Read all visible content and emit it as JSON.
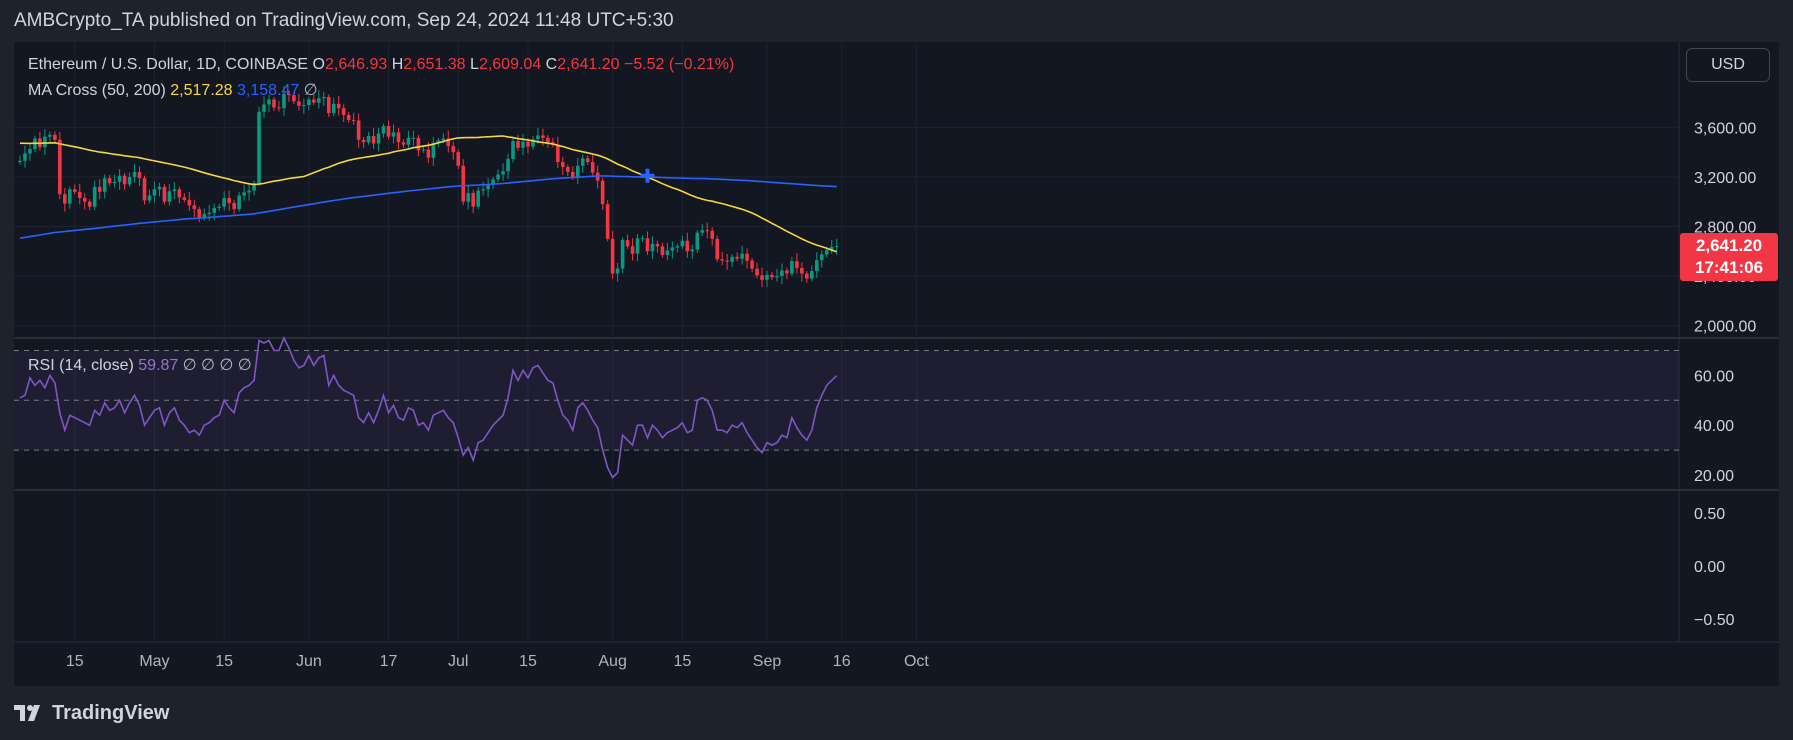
{
  "header": {
    "publisher_line": "AMBCrypto_TA published on TradingView.com, Sep 24, 2024 11:48 UTC+5:30"
  },
  "legend": {
    "symbol": "Ethereum / U.S. Dollar, 1D, COINBASE",
    "o_label": "O",
    "o_value": "2,646.93",
    "h_label": "H",
    "h_value": "2,651.38",
    "l_label": "L",
    "l_value": "2,609.04",
    "c_label": "C",
    "c_value": "2,641.20",
    "change": "−5.52 (−0.21%)",
    "ma_label": "MA Cross (50, 200)",
    "ma50_value": "2,517.28",
    "ma200_value": "3,158.47",
    "ma_empty": "∅",
    "rsi_label": "RSI (14, close)",
    "rsi_value": "59.87",
    "rsi_empties": "∅  ∅  ∅  ∅"
  },
  "currency_button": "USD",
  "last_price": {
    "price": "2,641.20",
    "countdown": "17:41:06"
  },
  "footer": {
    "brand": "TradingView"
  },
  "colors": {
    "up": "#089981",
    "down": "#f23645",
    "ma50": "#f5d742",
    "ma200": "#2962ff",
    "rsi": "#7e57c2",
    "rsi_band": "#7e57c2"
  },
  "chart_data": [
    {
      "type": "candlestick",
      "title": "Ethereum / U.S. Dollar, 1D, COINBASE",
      "x_tick_labels": [
        "15",
        "May",
        "15",
        "Jun",
        "17",
        "Jul",
        "15",
        "Aug",
        "15",
        "Sep",
        "16",
        "Oct"
      ],
      "x_tick_dates": [
        "2024-04-15",
        "2024-05-01",
        "2024-05-15",
        "2024-06-01",
        "2024-06-17",
        "2024-07-01",
        "2024-07-15",
        "2024-08-01",
        "2024-08-15",
        "2024-09-01",
        "2024-09-16",
        "2024-10-01"
      ],
      "y_tick_labels": [
        "3,600.00",
        "3,200.00",
        "2,800.00",
        "2,400.00",
        "2,000.00"
      ],
      "y_ticks": [
        3600,
        3200,
        2800,
        2400,
        2000
      ],
      "ylim": [
        1900,
        3950
      ],
      "start_date": "2024-04-04",
      "end_date": "2024-09-24",
      "closes": [
        3330,
        3390,
        3425,
        3510,
        3440,
        3525,
        3540,
        3500,
        3060,
        2985,
        3100,
        3080,
        3030,
        3000,
        2960,
        3120,
        3080,
        3190,
        3150,
        3160,
        3210,
        3140,
        3200,
        3240,
        3190,
        3010,
        3050,
        3100,
        3120,
        3000,
        3085,
        3100,
        3035,
        3015,
        2970,
        2940,
        2870,
        2900,
        2910,
        2950,
        2960,
        3030,
        2990,
        2940,
        3050,
        3075,
        3090,
        3150,
        3725,
        3785,
        3825,
        3760,
        3755,
        3870,
        3860,
        3810,
        3775,
        3780,
        3825,
        3800,
        3835,
        3845,
        3715,
        3790,
        3755,
        3700,
        3660,
        3655,
        3500,
        3480,
        3530,
        3470,
        3550,
        3610,
        3525,
        3560,
        3480,
        3460,
        3515,
        3515,
        3415,
        3420,
        3355,
        3475,
        3495,
        3510,
        3450,
        3400,
        3290,
        3000,
        3070,
        2960,
        3090,
        3100,
        3140,
        3180,
        3220,
        3245,
        3345,
        3490,
        3435,
        3485,
        3445,
        3505,
        3535,
        3515,
        3480,
        3460,
        3320,
        3280,
        3240,
        3200,
        3290,
        3350,
        3320,
        3235,
        3170,
        2980,
        2700,
        2420,
        2460,
        2690,
        2640,
        2580,
        2705,
        2705,
        2600,
        2660,
        2640,
        2570,
        2605,
        2630,
        2640,
        2685,
        2600,
        2615,
        2750,
        2770,
        2765,
        2700,
        2535,
        2525,
        2515,
        2555,
        2540,
        2580,
        2525,
        2460,
        2405,
        2370,
        2410,
        2390,
        2400,
        2445,
        2420,
        2520,
        2465,
        2420,
        2380,
        2440,
        2528,
        2575,
        2610,
        2635,
        2641.2
      ]
    },
    {
      "type": "line",
      "title": "MA Cross (50, 200)",
      "series": [
        {
          "name": "MA 50",
          "last_value": 2517.28
        },
        {
          "name": "MA 200",
          "last_value": 3158.47
        }
      ]
    },
    {
      "type": "line",
      "title": "RSI (14, close)",
      "y_tick_labels": [
        "60.00",
        "40.00",
        "20.00"
      ],
      "y_ticks": [
        60,
        40,
        20
      ],
      "ylim": [
        14,
        75
      ],
      "bands": [
        70,
        50,
        30
      ],
      "values": [
        51,
        52,
        59,
        56,
        58,
        55,
        60,
        57,
        45,
        38,
        44,
        43,
        42,
        41,
        40,
        46,
        44,
        49,
        46,
        47,
        50,
        45,
        49,
        52,
        48,
        40,
        43,
        46,
        47,
        40,
        45,
        47,
        42,
        40,
        37,
        38,
        36,
        40,
        41,
        43,
        44,
        50,
        47,
        45,
        53,
        55,
        56,
        58,
        74,
        73,
        74,
        70,
        70,
        75,
        71,
        66,
        63,
        64,
        68,
        64,
        67,
        68,
        56,
        60,
        56,
        54,
        53,
        52,
        43,
        41,
        45,
        41,
        46,
        52,
        45,
        48,
        43,
        42,
        47,
        46,
        40,
        41,
        38,
        44,
        45,
        46,
        43,
        41,
        35,
        28,
        31,
        26,
        33,
        34,
        37,
        40,
        42,
        44,
        51,
        62,
        58,
        62,
        59,
        63,
        64,
        61,
        58,
        57,
        50,
        44,
        42,
        38,
        47,
        49,
        46,
        42,
        39,
        30,
        23,
        19,
        21,
        36,
        34,
        32,
        40,
        40,
        35,
        40,
        38,
        35,
        37,
        38,
        39,
        41,
        37,
        38,
        50,
        51,
        50,
        46,
        38,
        38,
        37,
        40,
        39,
        41,
        37,
        34,
        31,
        29,
        33,
        32,
        33,
        36,
        35,
        43,
        39,
        36,
        34,
        38,
        47,
        52,
        56,
        58,
        59.87
      ]
    },
    {
      "type": "line",
      "title": "",
      "y_tick_labels": [
        "0.50",
        "0.00",
        "−0.50"
      ],
      "y_ticks": [
        0.5,
        0,
        -0.5
      ],
      "ylim": [
        -0.72,
        0.72
      ]
    }
  ]
}
